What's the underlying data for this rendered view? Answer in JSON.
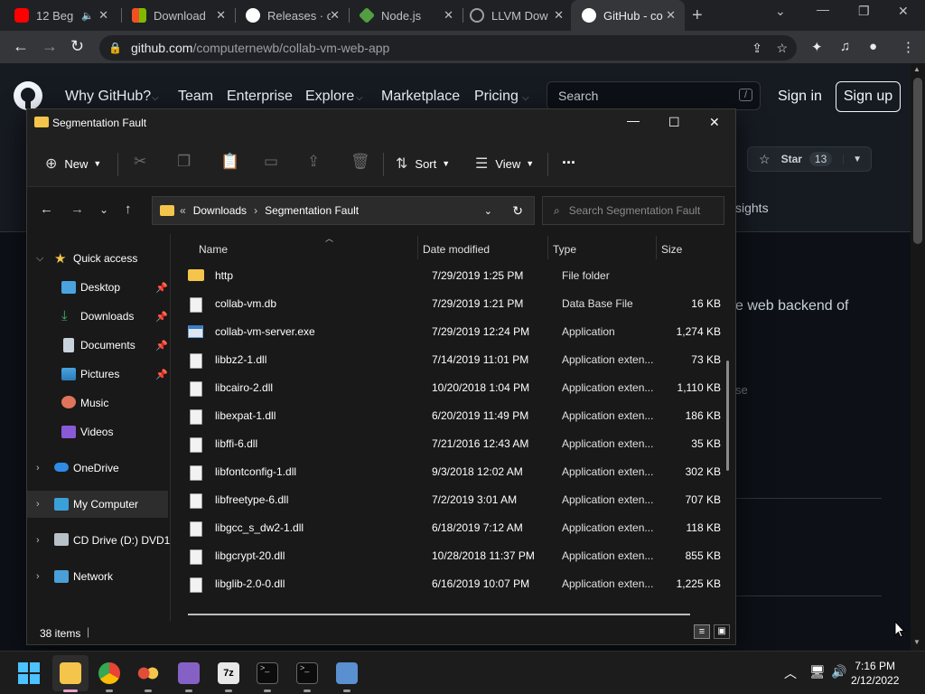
{
  "browser": {
    "tabs": [
      {
        "title": "12 Beg",
        "icon": "youtube-icon",
        "color": "#ff0000"
      },
      {
        "title": "Download",
        "icon": "microsoft-icon",
        "color": "#f25022"
      },
      {
        "title": "Releases · c",
        "icon": "github-icon",
        "color": "#ffffff"
      },
      {
        "title": "Node.js",
        "icon": "nodejs-icon",
        "color": "#539e43"
      },
      {
        "title": "LLVM Dow",
        "icon": "globe-icon",
        "color": "#9aa0a6"
      },
      {
        "title": "GitHub - co",
        "icon": "github-icon",
        "color": "#ffffff",
        "active": true
      }
    ],
    "url_host": "github.com",
    "url_path": "/computernewb/collab-vm-web-app"
  },
  "github": {
    "nav": [
      "Why GitHub?",
      "Team",
      "Enterprise",
      "Explore",
      "Marketplace",
      "Pricing"
    ],
    "search_placeholder": "Search",
    "search_shortcut": "/",
    "sign_in": "Sign in",
    "sign_up": "Sign up",
    "star_label": "Star",
    "star_count": "13",
    "tab_fragment": "sights",
    "desc_fragment": "e web backend of",
    "faded_fragment": "se"
  },
  "explorer": {
    "title": "Segmentation Fault",
    "toolbar": {
      "new": "New",
      "sort": "Sort",
      "view": "View",
      "more": "..."
    },
    "breadcrumb": [
      "Downloads",
      "Segmentation Fault"
    ],
    "breadcrumb_overflow": "«",
    "search_placeholder": "Search Segmentation Fault",
    "nav": {
      "quick_access": "Quick access",
      "desktop": "Desktop",
      "downloads": "Downloads",
      "documents": "Documents",
      "pictures": "Pictures",
      "music": "Music",
      "videos": "Videos",
      "onedrive": "OneDrive",
      "my_computer": "My Computer",
      "cd_drive": "CD Drive (D:) DVD1",
      "network": "Network"
    },
    "columns": {
      "name": "Name",
      "date": "Date modified",
      "type": "Type",
      "size": "Size"
    },
    "files": [
      {
        "name": "http",
        "date": "7/29/2019 1:25 PM",
        "type": "File folder",
        "size": "",
        "kind": "folder"
      },
      {
        "name": "collab-vm.db",
        "date": "7/29/2019 1:21 PM",
        "type": "Data Base File",
        "size": "16 KB",
        "kind": "file"
      },
      {
        "name": "collab-vm-server.exe",
        "date": "7/29/2019 12:24 PM",
        "type": "Application",
        "size": "1,274 KB",
        "kind": "exe"
      },
      {
        "name": "libbz2-1.dll",
        "date": "7/14/2019 11:01 PM",
        "type": "Application exten...",
        "size": "73 KB",
        "kind": "file"
      },
      {
        "name": "libcairo-2.dll",
        "date": "10/20/2018 1:04 PM",
        "type": "Application exten...",
        "size": "1,110 KB",
        "kind": "file"
      },
      {
        "name": "libexpat-1.dll",
        "date": "6/20/2019 11:49 PM",
        "type": "Application exten...",
        "size": "186 KB",
        "kind": "file"
      },
      {
        "name": "libffi-6.dll",
        "date": "7/21/2016 12:43 AM",
        "type": "Application exten...",
        "size": "35 KB",
        "kind": "file"
      },
      {
        "name": "libfontconfig-1.dll",
        "date": "9/3/2018 12:02 AM",
        "type": "Application exten...",
        "size": "302 KB",
        "kind": "file"
      },
      {
        "name": "libfreetype-6.dll",
        "date": "7/2/2019 3:01 AM",
        "type": "Application exten...",
        "size": "707 KB",
        "kind": "file"
      },
      {
        "name": "libgcc_s_dw2-1.dll",
        "date": "6/18/2019 7:12 AM",
        "type": "Application exten...",
        "size": "118 KB",
        "kind": "file"
      },
      {
        "name": "libgcrypt-20.dll",
        "date": "10/28/2018 11:37 PM",
        "type": "Application exten...",
        "size": "855 KB",
        "kind": "file"
      },
      {
        "name": "libglib-2.0-0.dll",
        "date": "6/16/2019 10:07 PM",
        "type": "Application exten...",
        "size": "1,225 KB",
        "kind": "file"
      }
    ],
    "status": "38 items"
  },
  "taskbar": {
    "time": "7:16 PM",
    "date": "2/12/2022"
  }
}
